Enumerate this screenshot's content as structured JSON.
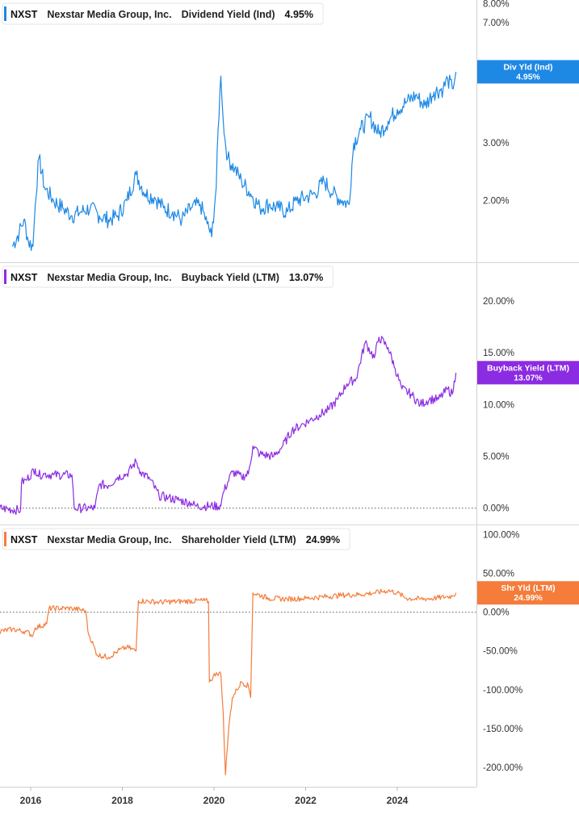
{
  "chart_data": [
    {
      "type": "line",
      "ticker": "NXST",
      "company": "Nexstar Media Group, Inc.",
      "metric": "Dividend Yield (Ind)",
      "current_value": "4.95%",
      "tag_label": "Div Yld (Ind)",
      "tag_value": "4.95%",
      "color": "#1e88e5",
      "y_scale": "log",
      "ylim": [
        1.35,
        8.2
      ],
      "yticks": [
        {
          "value": 8.0,
          "label": "8.00%"
        },
        {
          "value": 7.0,
          "label": "7.00%"
        },
        {
          "value": 5.0,
          "label": "5.00%"
        },
        {
          "value": 3.0,
          "label": "3.00%"
        },
        {
          "value": 2.0,
          "label": "2.00%"
        }
      ],
      "x": [
        2015.6,
        2015.75,
        2015.85,
        2015.95,
        2016.05,
        2016.1,
        2016.18,
        2016.3,
        2016.5,
        2016.7,
        2016.9,
        2017.1,
        2017.3,
        2017.5,
        2017.7,
        2017.9,
        2018.1,
        2018.3,
        2018.5,
        2018.7,
        2018.9,
        2019.1,
        2019.3,
        2019.5,
        2019.7,
        2019.85,
        2019.95,
        2020.05,
        2020.15,
        2020.22,
        2020.3,
        2020.45,
        2020.6,
        2020.8,
        2021.0,
        2021.2,
        2021.4,
        2021.6,
        2021.8,
        2022.0,
        2022.2,
        2022.4,
        2022.6,
        2022.8,
        2022.95,
        2023.05,
        2023.2,
        2023.4,
        2023.6,
        2023.8,
        2024.0,
        2024.2,
        2024.4,
        2024.6,
        2024.8,
        2025.0,
        2025.1,
        2025.2,
        2025.28
      ],
      "values": [
        1.45,
        1.6,
        1.75,
        1.5,
        1.45,
        1.95,
        2.7,
        2.2,
        2.0,
        1.9,
        1.8,
        1.85,
        1.9,
        1.8,
        1.75,
        1.8,
        2.0,
        2.4,
        2.1,
        2.05,
        1.9,
        1.85,
        1.75,
        1.9,
        1.95,
        1.7,
        1.55,
        2.2,
        4.8,
        3.2,
        2.7,
        2.5,
        2.3,
        2.1,
        1.9,
        1.95,
        1.9,
        1.85,
        2.0,
        2.05,
        2.1,
        2.3,
        2.1,
        2.0,
        1.95,
        3.0,
        3.3,
        3.6,
        3.2,
        3.5,
        3.8,
        4.0,
        4.2,
        3.9,
        4.3,
        4.4,
        4.7,
        4.4,
        4.95
      ]
    },
    {
      "type": "line",
      "ticker": "NXST",
      "company": "Nexstar Media Group, Inc.",
      "metric": "Buyback Yield (LTM)",
      "current_value": "13.07%",
      "tag_label": "Buyback Yield (LTM)",
      "tag_value": "13.07%",
      "color": "#8b2be2",
      "ylim": [
        -0.8,
        21.0
      ],
      "yticks": [
        {
          "value": 20.0,
          "label": "20.00%"
        },
        {
          "value": 15.0,
          "label": "15.00%"
        },
        {
          "value": 10.0,
          "label": "10.00%"
        },
        {
          "value": 5.0,
          "label": "5.00%"
        },
        {
          "value": 0.0,
          "label": "0.00%"
        }
      ],
      "x": [
        2015.3,
        2015.78,
        2015.8,
        2015.9,
        2016.1,
        2016.15,
        2016.3,
        2016.5,
        2016.9,
        2016.95,
        2017.3,
        2017.4,
        2017.5,
        2017.7,
        2017.9,
        2018.1,
        2018.3,
        2018.4,
        2018.6,
        2018.8,
        2019.0,
        2019.2,
        2019.5,
        2019.6,
        2019.9,
        2020.15,
        2020.2,
        2020.4,
        2020.6,
        2020.75,
        2020.85,
        2021.0,
        2021.3,
        2021.5,
        2021.7,
        2021.9,
        2022.1,
        2022.3,
        2022.5,
        2022.7,
        2022.9,
        2023.1,
        2023.3,
        2023.5,
        2023.6,
        2023.8,
        2023.95,
        2024.1,
        2024.3,
        2024.5,
        2024.7,
        2024.9,
        2025.1,
        2025.2,
        2025.28
      ],
      "values": [
        0.0,
        -0.2,
        2.5,
        2.7,
        3.8,
        3.2,
        3.3,
        3.2,
        3.2,
        0.0,
        0.0,
        0.0,
        2.3,
        2.2,
        3.0,
        3.3,
        4.5,
        3.5,
        2.8,
        1.2,
        1.0,
        0.8,
        0.5,
        0.2,
        0.2,
        0.2,
        1.5,
        3.5,
        3.0,
        3.3,
        6.0,
        5.2,
        5.0,
        6.0,
        7.5,
        8.0,
        8.5,
        9.0,
        9.5,
        10.5,
        12.0,
        12.5,
        16.0,
        14.5,
        16.5,
        15.5,
        13.5,
        11.5,
        11.0,
        10.0,
        10.5,
        10.5,
        11.5,
        11.0,
        13.07
      ]
    },
    {
      "type": "line",
      "ticker": "NXST",
      "company": "Nexstar Media Group, Inc.",
      "metric": "Shareholder Yield (LTM)",
      "current_value": "24.99%",
      "tag_label": "Shr Yld (LTM)",
      "tag_value": "24.99%",
      "color": "#f57c3a",
      "ylim": [
        -220.0,
        108.0
      ],
      "yticks": [
        {
          "value": 100.0,
          "label": "100.00%"
        },
        {
          "value": 50.0,
          "label": "50.00%"
        },
        {
          "value": 0.0,
          "label": "0.00%"
        },
        {
          "value": -50.0,
          "label": "-50.00%"
        },
        {
          "value": -100.0,
          "label": "-100.00%"
        },
        {
          "value": -150.0,
          "label": "-150.00%"
        },
        {
          "value": -200.0,
          "label": "-200.00%"
        }
      ],
      "x": [
        2015.3,
        2015.6,
        2015.9,
        2016.05,
        2016.1,
        2016.35,
        2016.4,
        2016.9,
        2017.2,
        2017.25,
        2017.45,
        2017.7,
        2017.9,
        2018.1,
        2018.3,
        2018.35,
        2018.8,
        2019.3,
        2019.8,
        2019.88,
        2019.9,
        2020.05,
        2020.15,
        2020.2,
        2020.25,
        2020.32,
        2020.4,
        2020.5,
        2020.6,
        2020.75,
        2020.8,
        2020.85,
        2021.2,
        2021.6,
        2022.0,
        2022.4,
        2022.8,
        2023.2,
        2023.5,
        2023.8,
        2024.0,
        2024.2,
        2024.5,
        2024.8,
        2025.1,
        2025.2,
        2025.28
      ],
      "values": [
        -25,
        -22,
        -25,
        -30,
        -20,
        -15,
        5,
        5,
        2,
        -25,
        -55,
        -58,
        -50,
        -45,
        -50,
        15,
        13,
        14,
        15,
        14,
        -90,
        -78,
        -80,
        -130,
        -210,
        -150,
        -110,
        -100,
        -90,
        -95,
        -110,
        25,
        18,
        17,
        18,
        20,
        22,
        23,
        25,
        28,
        25,
        18,
        17,
        18,
        20,
        21,
        24.99
      ]
    }
  ],
  "x_axis": {
    "ticks": [
      {
        "value": 2016,
        "label": "2016"
      },
      {
        "value": 2018,
        "label": "2018"
      },
      {
        "value": 2020,
        "label": "2020"
      },
      {
        "value": 2022,
        "label": "2022"
      },
      {
        "value": 2024,
        "label": "2024"
      }
    ]
  }
}
